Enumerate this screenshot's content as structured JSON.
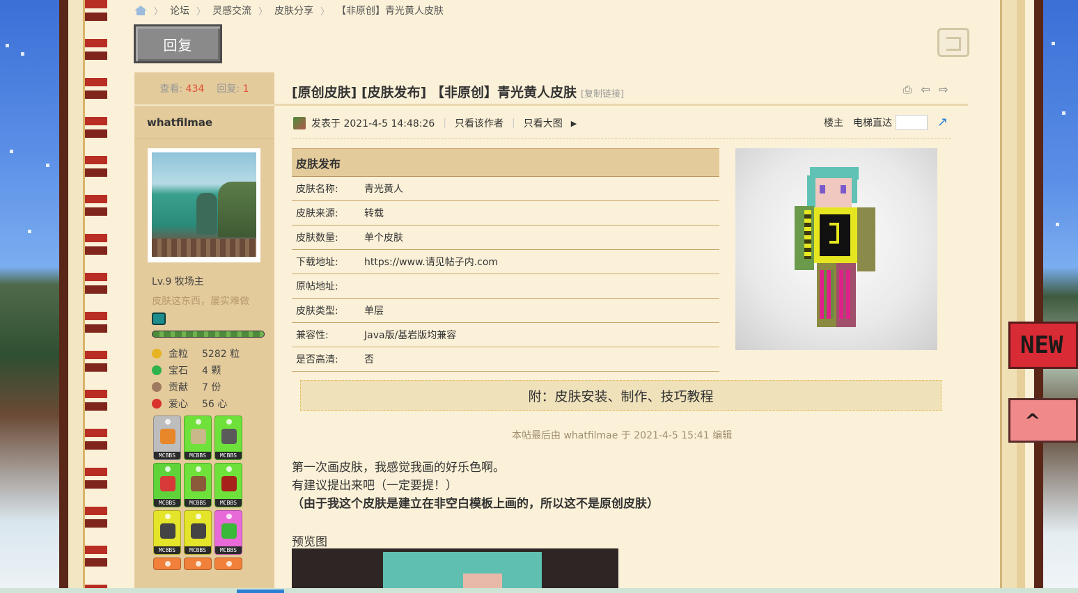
{
  "breadcrumb": {
    "items": [
      "论坛",
      "灵感交流",
      "皮肤分享",
      "【非原创】青光黄人皮肤"
    ]
  },
  "reply_button": "回复",
  "stats": {
    "views_label": "查看:",
    "views": "434",
    "replies_label": "回复:",
    "replies": "1"
  },
  "user": {
    "name": "whatfilmae",
    "level": "Lv.9 牧场主",
    "motto": "皮肤这东西，屡实难做",
    "level_progress": 1.0,
    "props": [
      {
        "label": "金粒",
        "value": "5282 粒",
        "color": "#e6b422",
        "icon": "gold-nugget-icon"
      },
      {
        "label": "宝石",
        "value": "4 颗",
        "color": "#2fb24a",
        "icon": "emerald-icon"
      },
      {
        "label": "贡献",
        "value": "7 份",
        "color": "#a07a60",
        "icon": "contribution-icon"
      },
      {
        "label": "爱心",
        "value": "56 心",
        "color": "#d8322a",
        "icon": "apple-icon"
      }
    ],
    "badge_tag": "MCBBS"
  },
  "post": {
    "title": "[原创皮肤] [皮肤发布] 【非原创】青光黄人皮肤",
    "copy_link": "[复制链接]",
    "posted_at": "发表于 2021-4-5 14:48:26",
    "only_author": "只看该作者",
    "only_images": "只看大图",
    "floor": "楼主",
    "jump_label": "电梯直达",
    "table_head": "皮肤发布",
    "rows": [
      {
        "key": "皮肤名称:",
        "value": "青光黄人"
      },
      {
        "key": "皮肤来源:",
        "value": "转载"
      },
      {
        "key": "皮肤数量:",
        "value": "单个皮肤"
      },
      {
        "key": "下载地址:",
        "value": "https://www.请见帖子内.com"
      },
      {
        "key": "原帖地址:",
        "value": ""
      },
      {
        "key": "皮肤类型:",
        "value": "单层"
      },
      {
        "key": "兼容性:",
        "value": "Java版/基岩版均兼容"
      },
      {
        "key": "是否高清:",
        "value": "否"
      }
    ],
    "tutorial_link": "附：皮肤安装、制作、技巧教程",
    "edit_note": "本帖最后由 whatfilmae 于 2021-4-5 15:41 编辑",
    "body_line1": "第一次画皮肤，我感觉我画的好乐色啊。",
    "body_line2": "有建议提出来吧（一定要提！）",
    "body_line3": "（由于我这个皮肤是建立在非空白模板上画的，所以这不是原创皮肤）",
    "preview_label": "预览图"
  },
  "floating": {
    "new_label": "NEW",
    "up_label": "^"
  },
  "colors": {
    "accent": "#e0503a",
    "page_bg": "#fbf1d8",
    "panel": "#e4cb9b"
  }
}
